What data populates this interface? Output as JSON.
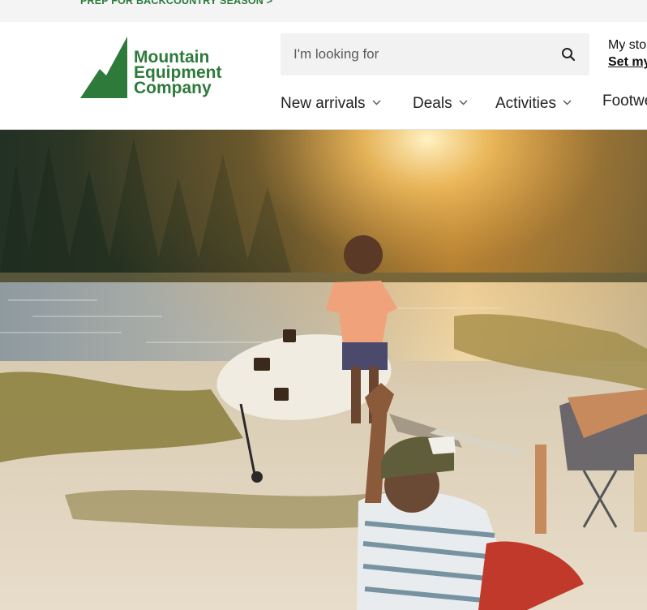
{
  "promo": {
    "text": "PREP FOR BACKCOUNTRY SEASON >"
  },
  "logo": {
    "line1": "Mountain",
    "line2": "Equipment",
    "line3": "Company",
    "color": "#2d7a3a"
  },
  "search": {
    "placeholder": "I'm looking for",
    "icon": "search-icon"
  },
  "store": {
    "label": "My store",
    "link": "Set my store"
  },
  "nav": {
    "items": [
      {
        "label": "New arrivals"
      },
      {
        "label": "Deals"
      },
      {
        "label": "Activities"
      },
      {
        "label": "Footwear"
      }
    ],
    "chevron_icon": "chevron-down-icon"
  },
  "colors": {
    "brand_green": "#2d7a3a",
    "promo_bg": "#f4f4f4",
    "search_bg": "#f2f2f2"
  }
}
